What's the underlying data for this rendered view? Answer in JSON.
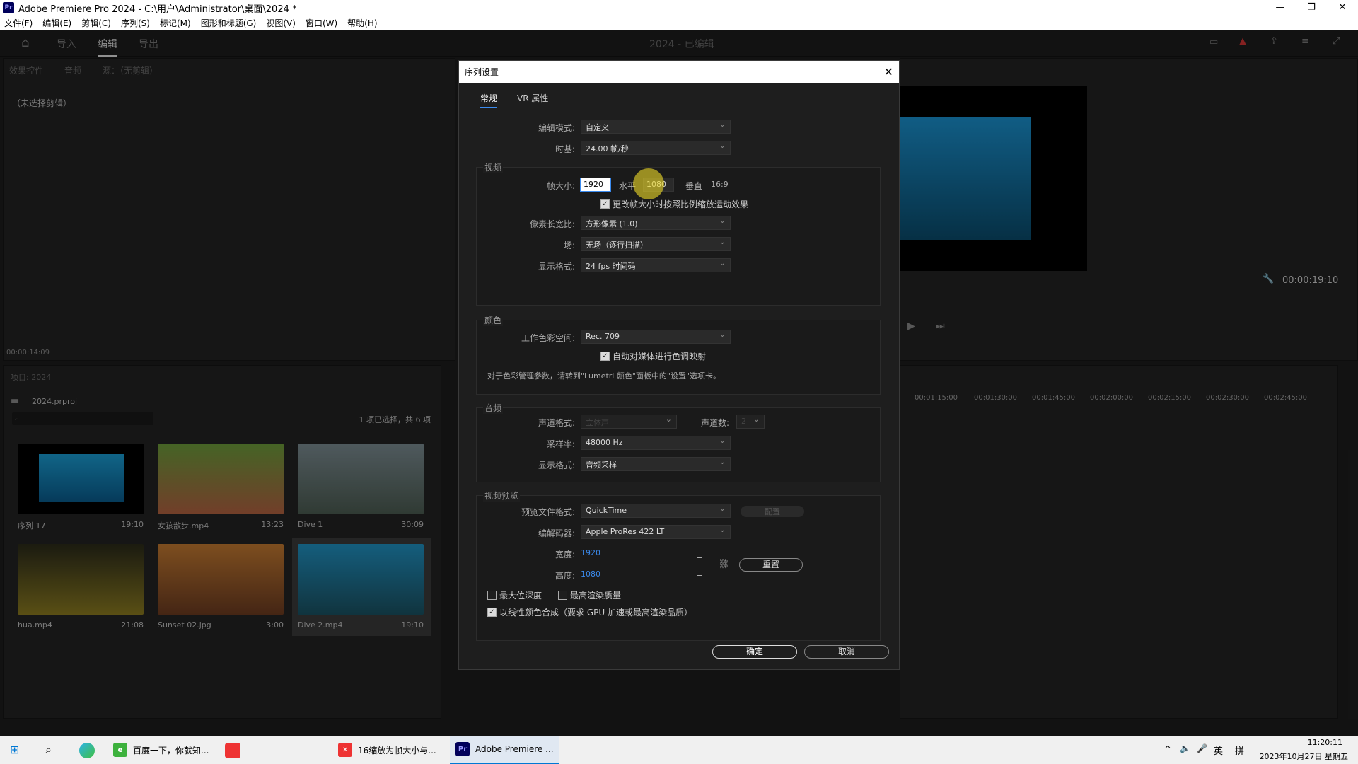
{
  "window": {
    "title": "Adobe Premiere Pro 2024 - C:\\用户\\Administrator\\桌面\\2024 *"
  },
  "menu": [
    "文件(F)",
    "编辑(E)",
    "剪辑(C)",
    "序列(S)",
    "标记(M)",
    "图形和标题(G)",
    "视图(V)",
    "窗口(W)",
    "帮助(H)"
  ],
  "appbar": {
    "tabs": [
      "导入",
      "编辑",
      "导出"
    ],
    "project_title": "2024 - 已编辑"
  },
  "source_panel": {
    "tabs": [
      "效果控件",
      "音频",
      "源：（无剪辑）"
    ],
    "no_clip": "（未选择剪辑）",
    "timecode": "00:00:14:09"
  },
  "project_panel": {
    "title": "项目: 2024",
    "file": "2024.prproj",
    "selection": "1 项已选择，共 6 项",
    "items": [
      {
        "name": "序列 17",
        "duration": "19:10"
      },
      {
        "name": "女孩散步.mp4",
        "duration": "13:23"
      },
      {
        "name": "Dive 1",
        "duration": "30:09"
      },
      {
        "name": "hua.mp4",
        "duration": "21:08"
      },
      {
        "name": "Sunset 02.jpg",
        "duration": "3:00"
      },
      {
        "name": "Dive 2.mp4",
        "duration": "19:10"
      }
    ]
  },
  "program": {
    "timecode": "00:00:19:10"
  },
  "timeline": {
    "ticks": [
      "00:01:15:00",
      "00:01:30:00",
      "00:01:45:00",
      "00:02:00:00",
      "00:02:15:00",
      "00:02:30:00",
      "00:02:45:00"
    ]
  },
  "dialog": {
    "title": "序列设置",
    "tabs": [
      "常规",
      "VR 属性"
    ],
    "edit_mode_label": "编辑模式:",
    "edit_mode": "自定义",
    "timebase_label": "时基:",
    "timebase": "24.00  帧/秒",
    "video": {
      "section": "视频",
      "frame_size_label": "帧大小:",
      "width": "1920",
      "h_label": "水平",
      "height": "1080",
      "v_label": "垂直",
      "aspect": "16:9",
      "scale_check": "更改帧大小时按照比例缩放运动效果",
      "par_label": "像素长宽比:",
      "par": "方形像素 (1.0)",
      "field_label": "场:",
      "field": "无场（逐行扫描）",
      "display_label": "显示格式:",
      "display": "24 fps 时间码"
    },
    "color": {
      "section": "颜色",
      "workspace_label": "工作色彩空间:",
      "workspace": "Rec. 709",
      "auto_tone": "自动对媒体进行色调映射",
      "note": "对于色彩管理参数，请转到\"Lumetri 颜色\"面板中的\"设置\"选项卡。"
    },
    "audio": {
      "section": "音频",
      "channel_format_label": "声道格式:",
      "channel_format": "立体声",
      "channels_label": "声道数:",
      "channels": "2",
      "sample_rate_label": "采样率:",
      "sample_rate": "48000 Hz",
      "display_label": "显示格式:",
      "display": "音频采样"
    },
    "preview": {
      "section": "视频预览",
      "file_format_label": "预览文件格式:",
      "file_format": "QuickTime",
      "config": "配置",
      "codec_label": "编解码器:",
      "codec": "Apple ProRes 422 LT",
      "width_label": "宽度:",
      "width": "1920",
      "height_label": "高度:",
      "height": "1080",
      "reset": "重置"
    },
    "max_bit_depth": "最大位深度",
    "max_render": "最高渲染质量",
    "linear_color": "以线性颜色合成（要求 GPU 加速或最高渲染品质）",
    "ok": "确定",
    "cancel": "取消"
  },
  "taskbar": {
    "items": [
      "百度一下，你就知...",
      "16缩放为帧大小与...",
      "Adobe Premiere ..."
    ],
    "ime": "英",
    "ime2": "拼",
    "time": "11:20:11",
    "date": "2023年10月27日 星期五"
  }
}
